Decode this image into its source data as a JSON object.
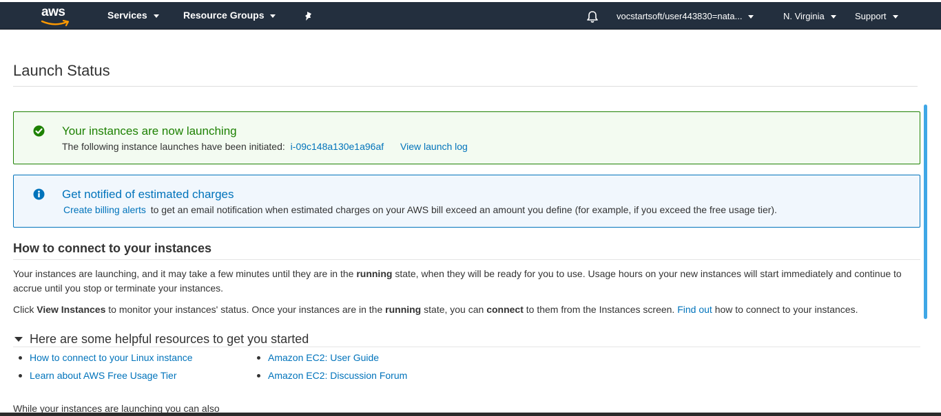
{
  "nav": {
    "logo": "aws",
    "services": "Services",
    "resource_groups": "Resource Groups",
    "account": "vocstartsoft/user443830=nata...",
    "region": "N. Virginia",
    "support": "Support"
  },
  "page": {
    "title": "Launch Status"
  },
  "success_alert": {
    "heading": "Your instances are now launching",
    "body_prefix": "The following instance launches have been initiated:",
    "instance_id": "i-09c148a130e1a96af",
    "view_log": "View launch log"
  },
  "info_alert": {
    "heading": "Get notified of estimated charges",
    "link": "Create billing alerts",
    "body": "to get an email notification when estimated charges on your AWS bill exceed an amount you define (for example, if you exceed the free usage tier)."
  },
  "connect": {
    "heading": "How to connect to your instances",
    "p1_a": "Your instances are launching, and it may take a few minutes until they are in the ",
    "p1_b": "running",
    "p1_c": " state, when they will be ready for you to use. Usage hours on your new instances will start immediately and continue to accrue until you stop or terminate your instances.",
    "p2_a": "Click ",
    "p2_b": "View Instances",
    "p2_c": " to monitor your instances' status. Once your instances are in the ",
    "p2_d": "running",
    "p2_e": " state, you can ",
    "p2_f": "connect",
    "p2_g": " to them from the Instances screen. ",
    "p2_link": "Find out",
    "p2_h": " how to connect to your instances."
  },
  "resources": {
    "heading": "Here are some helpful resources to get you started",
    "items": [
      "How to connect to your Linux instance",
      "Learn about AWS Free Usage Tier",
      "Amazon EC2: User Guide",
      "Amazon EC2: Discussion Forum"
    ]
  },
  "cutoff_text": "While your instances are launching you can also"
}
